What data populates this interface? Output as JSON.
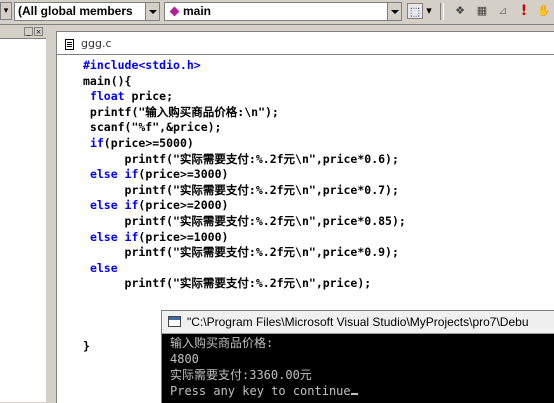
{
  "toolbar": {
    "class_combo": "(All global members",
    "member_combo": "main",
    "icons": [
      "wizard-icon",
      "dropdown-icon",
      "compile-icon",
      "build-icon",
      "stop-build-icon",
      "execute-icon",
      "breakpoint-icon"
    ]
  },
  "editor": {
    "filename": "ggg.c",
    "code_lines": [
      [
        {
          "t": "#include<stdio.h>",
          "k": true
        }
      ],
      [
        {
          "t": "main(){"
        }
      ],
      [
        {
          "t": " "
        },
        {
          "t": "float",
          "k": true
        },
        {
          "t": " price;"
        }
      ],
      [
        {
          "t": " printf(\"输入购买商品价格:\\n\");"
        }
      ],
      [
        {
          "t": " scanf(\"%f\",&price);"
        }
      ],
      [
        {
          "t": " "
        },
        {
          "t": "if",
          "k": true
        },
        {
          "t": "(price>=5000)"
        }
      ],
      [
        {
          "t": "      printf(\"实际需要支付:%.2f元\\n\",price*0.6);"
        }
      ],
      [
        {
          "t": " "
        },
        {
          "t": "else if",
          "k": true
        },
        {
          "t": "(price>=3000)"
        }
      ],
      [
        {
          "t": "      printf(\"实际需要支付:%.2f元\\n\",price*0.7);"
        }
      ],
      [
        {
          "t": " "
        },
        {
          "t": "else if",
          "k": true
        },
        {
          "t": "(price>=2000)"
        }
      ],
      [
        {
          "t": "      printf(\"实际需要支付:%.2f元\\n\",price*0.85);"
        }
      ],
      [
        {
          "t": " "
        },
        {
          "t": "else if",
          "k": true
        },
        {
          "t": "(price>=1000)"
        }
      ],
      [
        {
          "t": "      printf(\"实际需要支付:%.2f元\\n\",price*0.9);"
        }
      ],
      [
        {
          "t": " "
        },
        {
          "t": "else",
          "k": true
        }
      ],
      [
        {
          "t": "      printf(\"实际需要支付:%.2f元\\n\",price);"
        }
      ],
      [
        {
          "t": ""
        }
      ],
      [
        {
          "t": ""
        }
      ],
      [
        {
          "t": ""
        }
      ],
      [
        {
          "t": "}"
        }
      ]
    ],
    "keyword_color": "#0000ff"
  },
  "console": {
    "title": "\"C:\\Program Files\\Microsoft Visual Studio\\MyProjects\\pro7\\Debu",
    "lines": [
      "输入购买商品价格:",
      "4800",
      "实际需要支付:3360.00元",
      "Press any key to continue"
    ]
  }
}
